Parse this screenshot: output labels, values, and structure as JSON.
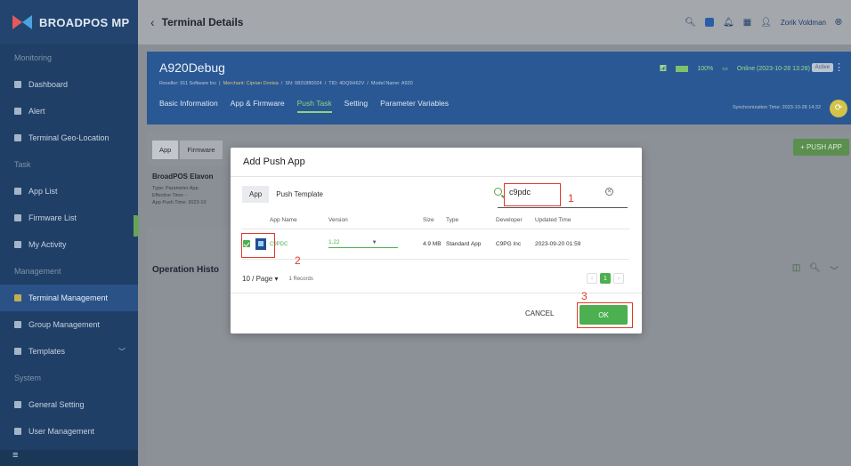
{
  "app": {
    "brand": "BROADPOS MP"
  },
  "sidebar": {
    "sections": [
      {
        "label": "Monitoring",
        "items": [
          {
            "label": "Dashboard"
          },
          {
            "label": "Alert"
          },
          {
            "label": "Terminal Geo-Location"
          }
        ]
      },
      {
        "label": "Task",
        "items": [
          {
            "label": "App List"
          },
          {
            "label": "Firmware List"
          },
          {
            "label": "My Activity"
          }
        ]
      },
      {
        "label": "Management",
        "items": [
          {
            "label": "Terminal Management"
          },
          {
            "label": "Group Management"
          },
          {
            "label": "Templates"
          }
        ]
      },
      {
        "label": "System",
        "items": [
          {
            "label": "General Setting"
          },
          {
            "label": "User Management"
          }
        ]
      }
    ],
    "menu_glyph": "≡"
  },
  "header": {
    "back_glyph": "‹",
    "title": "Terminal Details",
    "user": "Zorik Voldman"
  },
  "terminal": {
    "name": "A920Debug",
    "reseller": "Reseller: 911 Software Inc",
    "merchant": "Merchant: Ciprian Donisa",
    "sn": "SN: 0831880024",
    "tid": "TID: 4DQ9H62V",
    "model": "Model Name: A920",
    "battery": "100%",
    "online": "Online (2023-10-28 13:28)",
    "status": "Active",
    "tabs": [
      "Basic Information",
      "App & Firmware",
      "Push Task",
      "Setting",
      "Parameter Variables"
    ],
    "sync_time": "Synchronization Time: 2023-10-28 14:32"
  },
  "content": {
    "subtabs": [
      "App",
      "Firmware"
    ],
    "push_button": "+ PUSH APP",
    "card_title": "BroadPOS Elavon",
    "card_lines": [
      "Type: Parameter App",
      "Effective Time: -",
      "App Push Time: 2023-10"
    ],
    "op_history": "Operation Histo"
  },
  "modal": {
    "title": "Add Push App",
    "tabs": [
      "App",
      "Push Template"
    ],
    "search_value": "c9pdc",
    "columns": [
      "App Name",
      "Version",
      "Size",
      "Type",
      "Developer",
      "Updated Time"
    ],
    "rows": [
      {
        "name": "C9PDC",
        "version": "1.22",
        "size": "4.9 MB",
        "type": "Standard App",
        "developer": "C9PG Inc",
        "updated": "2023-09-20 01:59"
      }
    ],
    "page_size": "10 / Page",
    "records": "1 Records",
    "current_page": "1",
    "cancel_label": "CANCEL",
    "ok_label": "OK"
  },
  "annotations": [
    "1",
    "2",
    "3"
  ],
  "colors": {
    "primary_green": "#4caf50",
    "sidebar": "#1f3f66",
    "highlight": "#e0392b"
  }
}
